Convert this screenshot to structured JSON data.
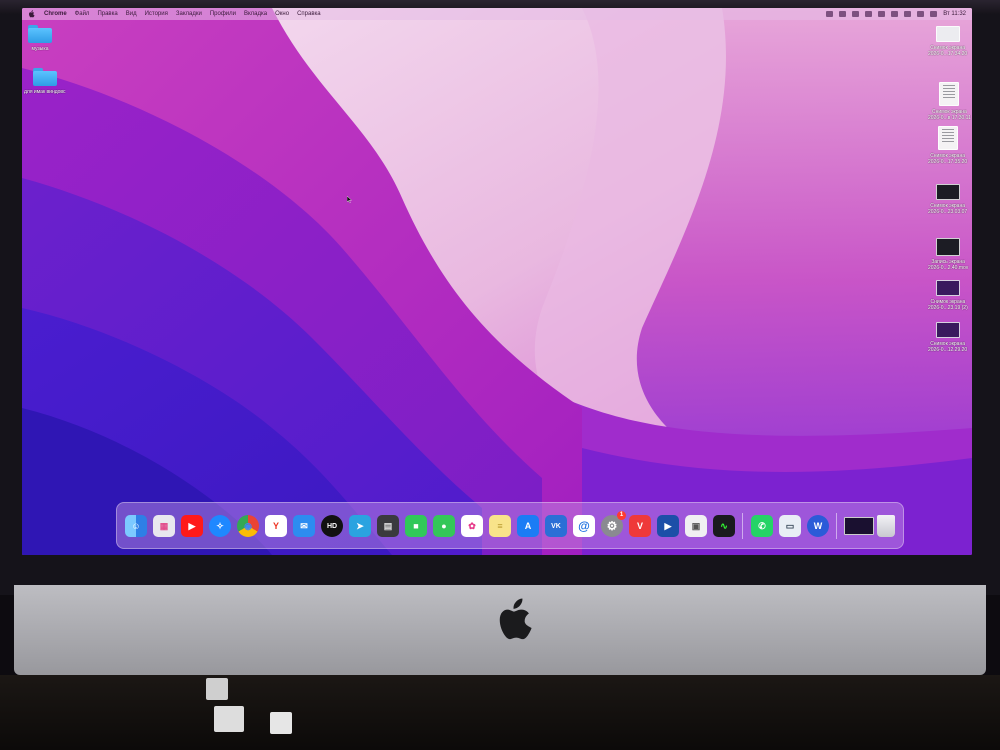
{
  "menubar": {
    "app_name": "Chrome",
    "menus": [
      "Файл",
      "Правка",
      "Вид",
      "История",
      "Закладки",
      "Профили",
      "Вкладка",
      "Окно",
      "Справка"
    ],
    "status_text": "Вт 11:32"
  },
  "desktop": {
    "folders": [
      {
        "label": "музыка"
      },
      {
        "label": "для имак виндовс"
      }
    ],
    "files": [
      {
        "label1": "Снимок экрана",
        "label2": "2026-0...17.34.20",
        "thumb": "image"
      },
      {
        "label1": "Снимок экрана",
        "label2": "2026-0...в 17.30.11",
        "thumb": "doc"
      },
      {
        "label1": "Снимок экрана",
        "label2": "2026-0...17.35.20",
        "thumb": "doc"
      },
      {
        "label1": "Снимок экрана",
        "label2": "2026-0...23.03.07",
        "thumb": "image"
      },
      {
        "label1": "Запись экрана",
        "label2": "2026-0...2.40.mov",
        "thumb": "video"
      },
      {
        "label1": "Снимок экрана",
        "label2": "2026-0...23.19 (2)",
        "thumb": "image"
      },
      {
        "label1": "Снимок экрана",
        "label2": "2026-0...12.29.20",
        "thumb": "image"
      }
    ]
  },
  "dock": {
    "apps": [
      {
        "name": "Finder",
        "glyph": "☺",
        "color": "#2e8ff0"
      },
      {
        "name": "Launchpad",
        "glyph": "▦",
        "color": "#e8e8ee"
      },
      {
        "name": "YouTube",
        "glyph": "▶",
        "color": "#ff1a1a"
      },
      {
        "name": "Safari",
        "glyph": "✧",
        "color": "#1e88ff"
      },
      {
        "name": "Chrome",
        "glyph": "◉",
        "color": "#f4f4f4"
      },
      {
        "name": "Yandex Browser",
        "glyph": "Y",
        "color": "#ffffff"
      },
      {
        "name": "Mail",
        "glyph": "✉",
        "color": "#2d8cf0"
      },
      {
        "name": "HD Player",
        "glyph": "HD",
        "color": "#111111"
      },
      {
        "name": "Telegram",
        "glyph": "➤",
        "color": "#2aa3e0"
      },
      {
        "name": "Calculator",
        "glyph": "▤",
        "color": "#3a3a3e"
      },
      {
        "name": "FaceTime",
        "glyph": "■",
        "color": "#31c85a"
      },
      {
        "name": "Messages",
        "glyph": "●",
        "color": "#34c759"
      },
      {
        "name": "Photos",
        "glyph": "✿",
        "color": "#ffffff"
      },
      {
        "name": "Notes",
        "glyph": "≡",
        "color": "#f8e38a"
      },
      {
        "name": "App Store",
        "glyph": "A",
        "color": "#1b7cf5"
      },
      {
        "name": "VK",
        "glyph": "VK",
        "color": "#2b6fd6"
      },
      {
        "name": "Mail.ru",
        "glyph": "@",
        "color": "#ffffff"
      },
      {
        "name": "System Preferences",
        "glyph": "⚙",
        "color": "#8a8a90",
        "badge": "1"
      },
      {
        "name": "Vivaldi",
        "glyph": "V",
        "color": "#ef3939"
      },
      {
        "name": "QuickTime",
        "glyph": "▶",
        "color": "#1c4fa8"
      },
      {
        "name": "Disk Utility",
        "glyph": "▣",
        "color": "#f0f0f2"
      },
      {
        "name": "Activity Monitor",
        "glyph": "∿",
        "color": "#1a1a1e"
      },
      {
        "name": "WhatsApp",
        "glyph": "✆",
        "color": "#25d366"
      },
      {
        "name": "Preview",
        "glyph": "▭",
        "color": "#e8eef5"
      },
      {
        "name": "Word",
        "glyph": "W",
        "color": "#2b5bd8"
      }
    ],
    "recent": [
      {
        "name": "Recent window",
        "glyph": "",
        "color": "#1a1030"
      },
      {
        "name": "Trash",
        "glyph": "",
        "color": "#dcdce4"
      }
    ]
  },
  "colors": {
    "wallpaper_dark": "#4a1cc8",
    "wallpaper_mid": "#b32ad0",
    "wallpaper_light": "#f2d6ee"
  }
}
